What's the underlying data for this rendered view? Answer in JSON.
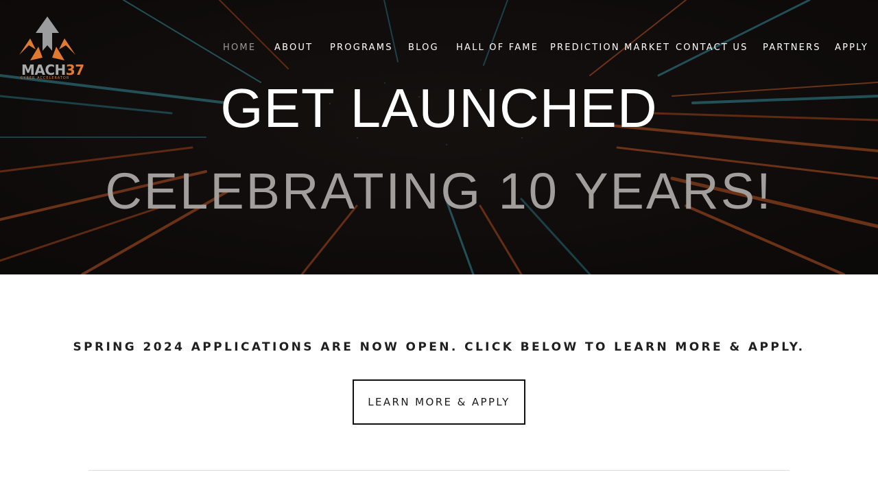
{
  "logo": {
    "name_part1": "MACH",
    "name_part2": "37",
    "tagline": "CYBER ACCELERATOR",
    "colors": {
      "gray": "#a9aaac",
      "orange": "#e07a30"
    }
  },
  "nav": {
    "items": [
      {
        "label": "HOME",
        "active": true
      },
      {
        "label": "ABOUT"
      },
      {
        "label": "PROGRAMS"
      },
      {
        "label": "BLOG"
      },
      {
        "label": "HALL OF FAME"
      },
      {
        "label": "PREDICTION MARKET"
      },
      {
        "label": "CONTACT US"
      },
      {
        "label": "PARTNERS"
      },
      {
        "label": "APPLY"
      }
    ]
  },
  "hero": {
    "title": "GET LAUNCHED",
    "subtitle": "CELEBRATING 10 YEARS!"
  },
  "main": {
    "announcement": "SPRING 2024 APPLICATIONS ARE NOW OPEN. CLICK BELOW TO LEARN MORE & APPLY.",
    "cta_label": "LEARN MORE & APPLY"
  },
  "colors": {
    "hero_bg": "#151110",
    "streak_orange": "#e0652a",
    "streak_teal": "#3fa6b8",
    "nav_active": "#9a9a9a",
    "subtitle": "#a29e9c",
    "text_dark": "#1f1f1f"
  }
}
